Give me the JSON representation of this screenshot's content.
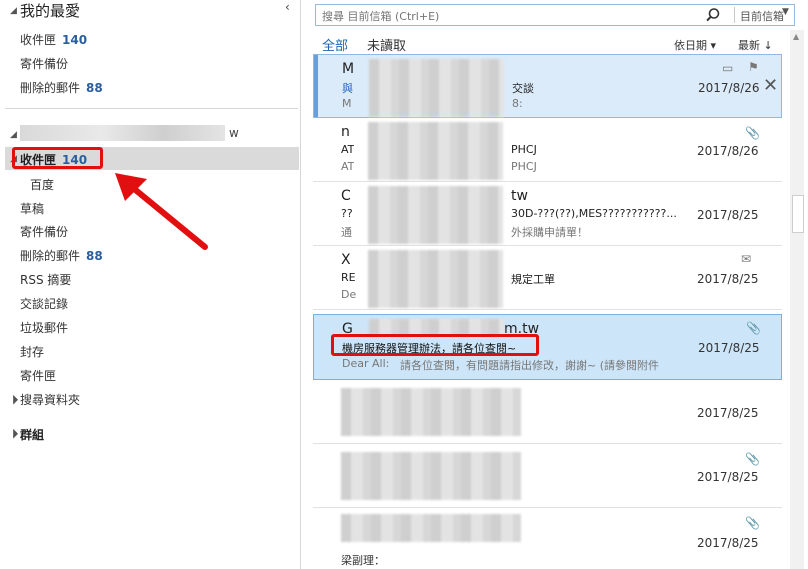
{
  "favorites": {
    "title": "我的最愛",
    "items": [
      {
        "label": "收件匣",
        "count": "140"
      },
      {
        "label": "寄件備份",
        "count": ""
      },
      {
        "label": "刪除的郵件",
        "count": "88"
      }
    ]
  },
  "account": {
    "name_tail": "w",
    "folders": [
      {
        "label": "收件匣",
        "count": "140"
      },
      {
        "label": "百度",
        "count": ""
      },
      {
        "label": "草稿",
        "count": ""
      },
      {
        "label": "寄件備份",
        "count": ""
      },
      {
        "label": "刪除的郵件",
        "count": "88"
      },
      {
        "label": "RSS 摘要",
        "count": ""
      },
      {
        "label": "交談記錄",
        "count": ""
      },
      {
        "label": "垃圾郵件",
        "count": ""
      },
      {
        "label": "封存",
        "count": ""
      },
      {
        "label": "寄件匣",
        "count": ""
      },
      {
        "label": "搜尋資料夾",
        "count": ""
      }
    ]
  },
  "groups": {
    "label": "群組"
  },
  "search": {
    "placeholder": "搜尋 目前信箱 (Ctrl+E)",
    "scope": "目前信箱"
  },
  "tabs": {
    "all": "全部",
    "unread": "未讀取"
  },
  "sort": {
    "by": "依日期",
    "order": "最新"
  },
  "emails": [
    {
      "sender": "M",
      "subject": "與",
      "subject_tail": "交談",
      "preview": "M",
      "preview_tail": "8:",
      "date": "2017/8/26"
    },
    {
      "sender": "n",
      "subject": "AT",
      "subject_tail": "PHCJ",
      "preview": "AT",
      "preview_tail": "PHCJ",
      "date": "2017/8/26"
    },
    {
      "sender": "C",
      "sender_tail": "tw",
      "subject": "??",
      "subject_tail": "30D-???(??),MES???????????...",
      "preview": "通",
      "preview_tail": "外採購申請單！",
      "date": "2017/8/25"
    },
    {
      "sender": "X",
      "subject": "RE",
      "subject_tail": "規定工單",
      "preview": "De",
      "preview_tail": "",
      "date": "2017/8/25"
    },
    {
      "sender": "G",
      "sender_tail": "m.tw",
      "subject": "機房服務器管理辦法，請各位查閱~",
      "preview": "Dear All:",
      "preview_tail": "請各位查閱，有問題請指出修改，謝謝~ (請參閱附件",
      "date": "2017/8/25"
    },
    {
      "sender": "",
      "subject": "",
      "preview": "",
      "date": "2017/8/25"
    },
    {
      "sender": "",
      "subject": "",
      "preview": "",
      "date": "2017/8/25"
    },
    {
      "sender": "",
      "subject": "",
      "preview": "梁副理：",
      "date": "2017/8/25"
    }
  ],
  "colors": {
    "accent": "#1e63b5",
    "highlight": "#e10f0f",
    "count": "#2a5e9e"
  }
}
